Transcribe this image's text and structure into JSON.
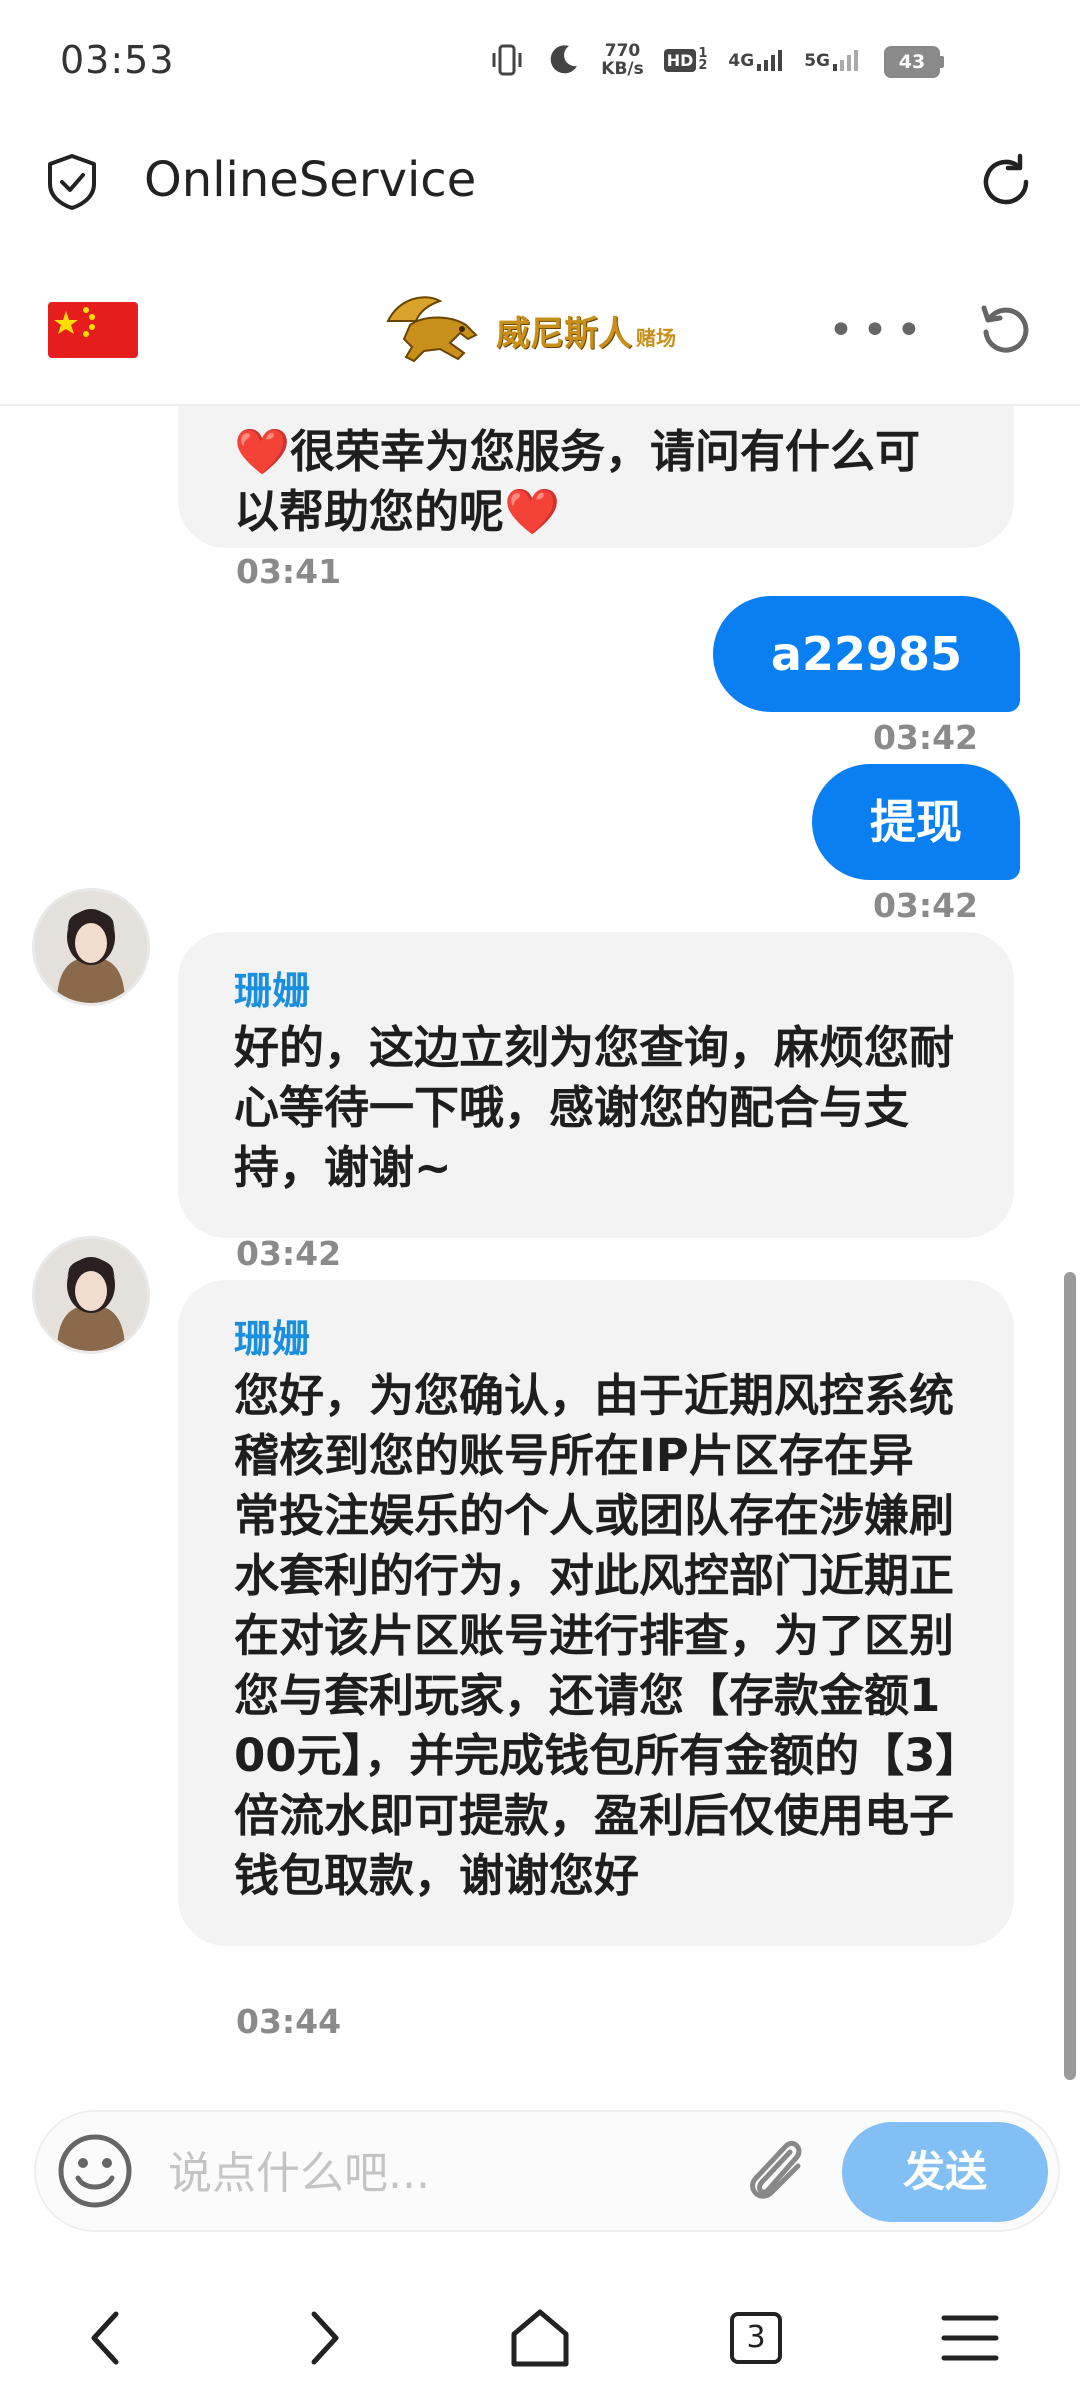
{
  "status_bar": {
    "time": "03:53",
    "net_speed_value": "770",
    "net_speed_unit": "KB/s",
    "hd_label": "HD",
    "hd_sub": "1 2",
    "signal_4g": "4G",
    "signal_5g": "5G",
    "battery": "43"
  },
  "browser": {
    "title": "OnlineService"
  },
  "site": {
    "logo_text": "威尼斯人",
    "logo_suffix": "赌场"
  },
  "chat": {
    "messages": [
      {
        "side": "left",
        "sender": "",
        "text": "❤️很荣幸为您服务，请问有什么可以帮助您的呢❤️",
        "time": "03:41"
      },
      {
        "side": "right",
        "text": "a22985",
        "time": "03:42"
      },
      {
        "side": "right",
        "text": "提现",
        "time": "03:42"
      },
      {
        "side": "left",
        "sender": "珊姗",
        "text": "好的，这边立刻为您查询，麻烦您耐心等待一下哦，感谢您的配合与支持，谢谢~",
        "time": "03:42"
      },
      {
        "side": "left",
        "sender": "珊姗",
        "text": "您好，为您确认，由于近期风控系统稽核到您的账号所在IP片区存在异常投注娱乐的个人或团队存在涉嫌刷水套利的行为，对此风控部门近期正在对该片区账号进行排查，为了区别您与套利玩家，还请您【存款金额100元】，并完成钱包所有金额的【3】倍流水即可提款，盈利后仅使用电子钱包取款，谢谢您好",
        "time": "03:44"
      }
    ]
  },
  "input": {
    "placeholder": "说点什么吧...",
    "value": "",
    "send_label": "发送"
  },
  "nav": {
    "tab_count": "3"
  },
  "colors": {
    "accent": "#0a7ff2",
    "send_button": "#82bff4",
    "sender_name": "#1a8fe0",
    "bubble_left": "#f3f3f4"
  }
}
